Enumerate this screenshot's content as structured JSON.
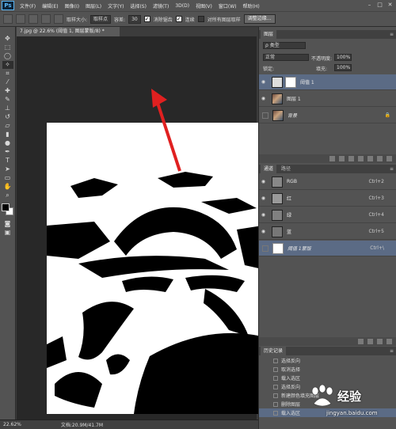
{
  "app": {
    "logo": "Ps"
  },
  "menu": [
    "文件(F)",
    "编辑(E)",
    "图像(I)",
    "图层(L)",
    "文字(Y)",
    "选择(S)",
    "滤镜(T)",
    "3D(D)",
    "视图(V)",
    "窗口(W)",
    "帮助(H)"
  ],
  "window_controls": [
    "–",
    "□",
    "✕"
  ],
  "options": {
    "sample_size_label": "取样大小:",
    "sample_size_value": "取样点",
    "tolerance_label": "容差:",
    "tolerance_value": "30",
    "antialias_label": "消除锯齿",
    "contiguous_label": "连续",
    "all_layers_label": "对所有图层取样",
    "refine_button": "调整边缘..."
  },
  "document": {
    "tab_title": "7.jpg @ 22.6% (阈值 1, 图层蒙版/8) *",
    "zoom": "22.62%",
    "doc_size": "文档:20.9M/41.7M"
  },
  "layers_panel": {
    "tabs": [
      "图层"
    ],
    "filter": "ρ 类型",
    "blend_mode": "正常",
    "opacity_label": "不透明度:",
    "opacity_value": "100%",
    "lock_label": "锁定:",
    "fill_label": "填充:",
    "fill_value": "100%",
    "layers": [
      {
        "name": "阈值 1",
        "visible": true,
        "selected": true
      },
      {
        "name": "图层 1",
        "visible": true,
        "selected": false
      },
      {
        "name": "背景",
        "visible": false,
        "selected": false,
        "locked": true
      }
    ]
  },
  "channels_panel": {
    "tabs": [
      "通道",
      "路径"
    ],
    "channels": [
      {
        "name": "RGB",
        "shortcut": "Ctrl+2"
      },
      {
        "name": "红",
        "shortcut": "Ctrl+3"
      },
      {
        "name": "绿",
        "shortcut": "Ctrl+4"
      },
      {
        "name": "蓝",
        "shortcut": "Ctrl+5"
      },
      {
        "name": "阈值 1蒙版",
        "shortcut": "Ctrl+\\",
        "selected": true
      }
    ]
  },
  "history_panel": {
    "tabs": [
      "历史记录"
    ],
    "items": [
      "选择反向",
      "取消选择",
      "载入选区",
      "选择反向",
      "新建颜色填充图层",
      "删除图层",
      "载入选区"
    ]
  },
  "watermark": {
    "brand": "Baidu",
    "text": "经验",
    "url": "jingyan.baidu.com"
  },
  "icons": [
    "move-tool-icon",
    "marquee-tool-icon",
    "lasso-tool-icon",
    "magic-wand-tool-icon",
    "crop-tool-icon",
    "eyedropper-tool-icon",
    "healing-tool-icon",
    "brush-tool-icon",
    "stamp-tool-icon",
    "history-brush-icon",
    "eraser-tool-icon",
    "gradient-tool-icon",
    "dodge-tool-icon",
    "pen-tool-icon",
    "type-tool-icon",
    "path-select-icon",
    "shape-tool-icon",
    "hand-tool-icon",
    "zoom-tool-icon",
    "eye-icon",
    "lock-icon",
    "red-arrow-annotation"
  ],
  "colors": {
    "chrome": "#535353",
    "dark": "#282828",
    "selection": "#5b6b85",
    "arrow": "#e02020"
  }
}
